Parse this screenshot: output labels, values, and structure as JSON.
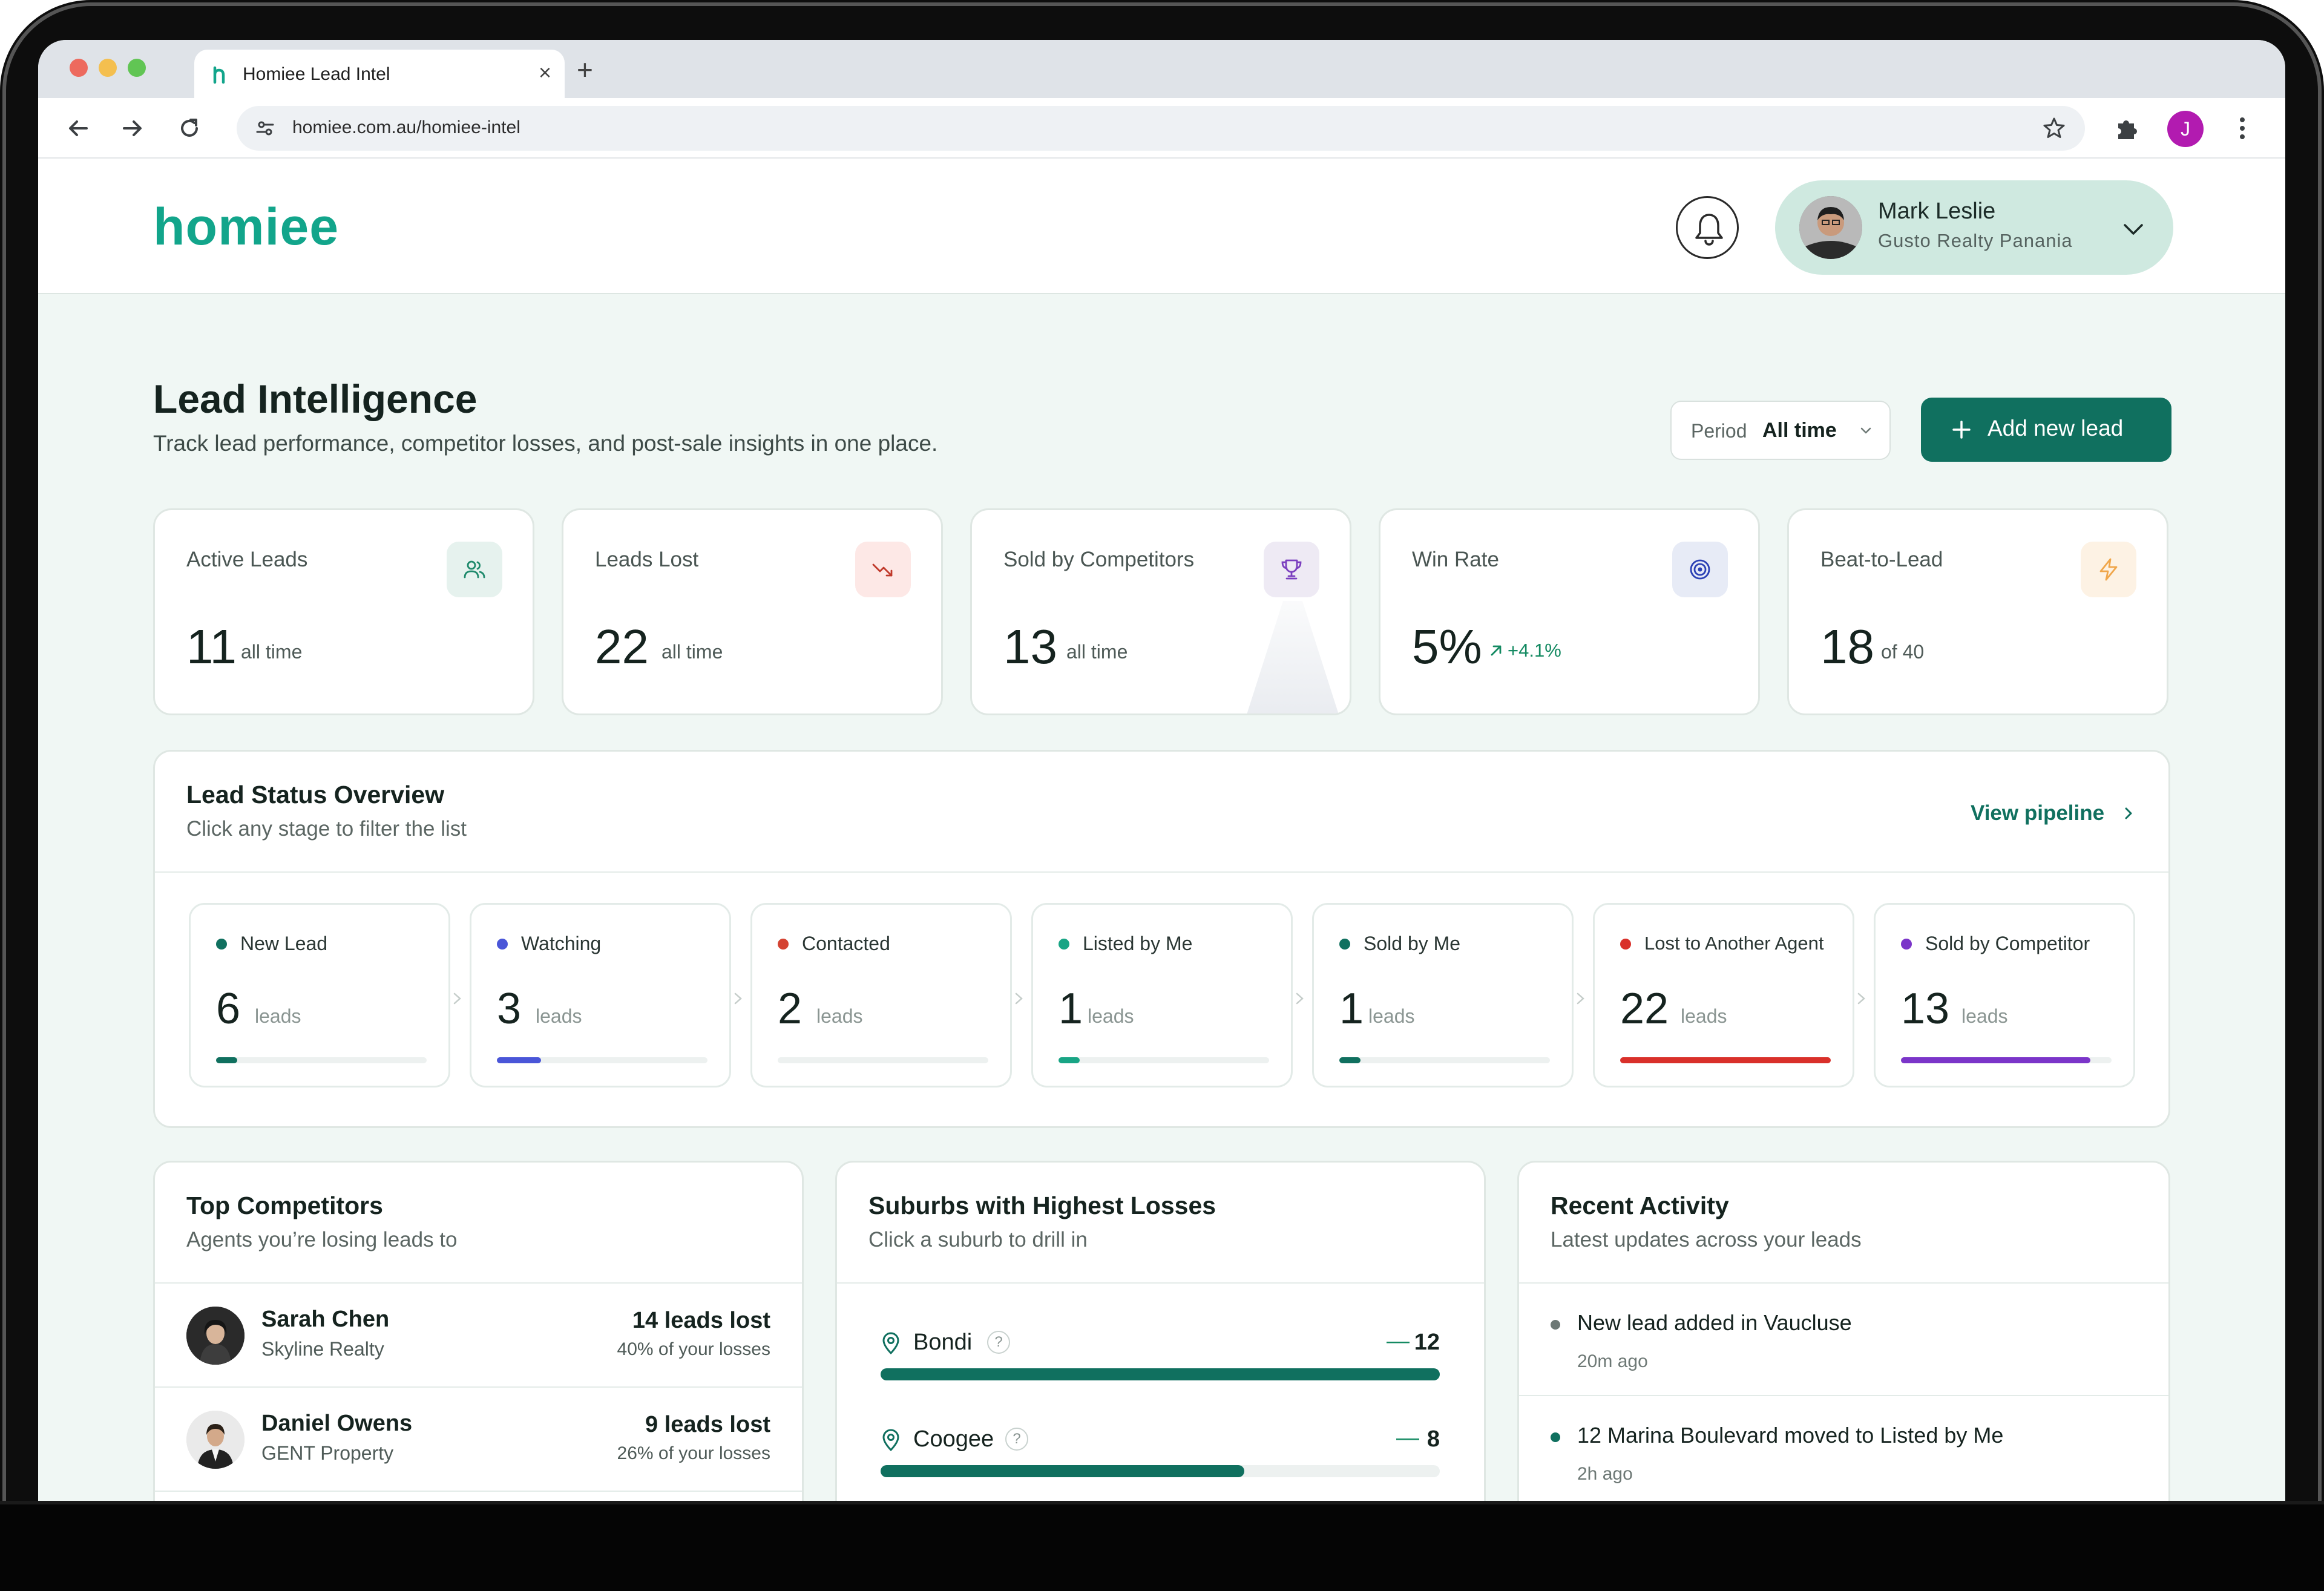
{
  "browser": {
    "tab_title": "Homiee Lead Intel",
    "url": "homiee.com.au/homiee-intel",
    "profile_initial": "J"
  },
  "header": {
    "logo": "homiee",
    "user": {
      "name": "Mark Leslie",
      "agency": "Gusto Realty Panania"
    }
  },
  "page": {
    "title": "Lead Intelligence",
    "subtitle": "Track lead performance, competitor losses, and post-sale insights in one place.",
    "period_label": "Period",
    "period_value": "All time",
    "add_button": "Add new lead"
  },
  "stats": [
    {
      "label": "Active Leads",
      "value": "11",
      "unit": "all time",
      "icon": "users-icon",
      "icon_color": "#1f8a6c",
      "icon_bg": "#e6f2ee"
    },
    {
      "label": "Leads Lost",
      "value": "22",
      "unit": "all time",
      "icon": "trending-down-icon",
      "icon_color": "#c0392b",
      "icon_bg": "#fde8e6"
    },
    {
      "label": "Sold by Competitors",
      "value": "13",
      "unit": "all time",
      "icon": "trophy-icon",
      "icon_color": "#7b3fbf",
      "icon_bg": "#eeeaf4"
    },
    {
      "label": "Win Rate",
      "value": "5%",
      "delta": "+4.1%",
      "icon": "target-icon",
      "icon_color": "#2b40b5",
      "icon_bg": "#e7ebf6"
    },
    {
      "label": "Beat-to-Lead",
      "value": "18",
      "unit": "of 40",
      "icon": "lightning-icon",
      "icon_color": "#f0a64a",
      "icon_bg": "#fdf2e4"
    }
  ],
  "status_overview": {
    "title": "Lead Status Overview",
    "subtitle": "Click any stage to filter the list",
    "view_link": "View pipeline",
    "unit": "leads",
    "stages": [
      {
        "name": "New Lead",
        "count": "6",
        "color": "#10705f",
        "fill": 0.1
      },
      {
        "name": "Watching",
        "count": "3",
        "color": "#4a56d8",
        "fill": 0.21
      },
      {
        "name": "Contacted",
        "count": "2",
        "color": "#d44332",
        "fill": 0.0
      },
      {
        "name": "Listed by Me",
        "count": "1",
        "color": "#19a585",
        "fill": 0.1
      },
      {
        "name": "Sold by Me",
        "count": "1",
        "color": "#10705f",
        "fill": 0.1
      },
      {
        "name": "Lost to Another Agent",
        "count": "22",
        "color": "#d9302a",
        "fill": 1.0
      },
      {
        "name": "Sold by Competitor",
        "count": "13",
        "color": "#7b35c9",
        "fill": 0.9
      }
    ]
  },
  "competitors": {
    "title": "Top Competitors",
    "subtitle": "Agents you’re losing leads to",
    "rows": [
      {
        "name": "Sarah Chen",
        "agency": "Skyline Realty",
        "lost": "14 leads lost",
        "share": "40% of your losses"
      },
      {
        "name": "Daniel Owens",
        "agency": "GENT Property",
        "lost": "9 leads lost",
        "share": "26% of your losses"
      }
    ]
  },
  "suburbs": {
    "title": "Suburbs with Highest Losses",
    "subtitle": "Click a suburb to drill in",
    "trend_symbol": "—",
    "rows": [
      {
        "name": "Bondi",
        "count": "12",
        "fill": 1.0
      },
      {
        "name": "Coogee",
        "count": "8",
        "fill": 0.65
      }
    ]
  },
  "activity": {
    "title": "Recent Activity",
    "subtitle": "Latest updates across your leads",
    "items": [
      {
        "text": "New lead added in Vaucluse",
        "time": "20m ago",
        "dot": "#6d7875"
      },
      {
        "text": "12 Marina Boulevard moved to Listed by Me",
        "time": "2h ago",
        "dot": "#10705f"
      }
    ]
  }
}
